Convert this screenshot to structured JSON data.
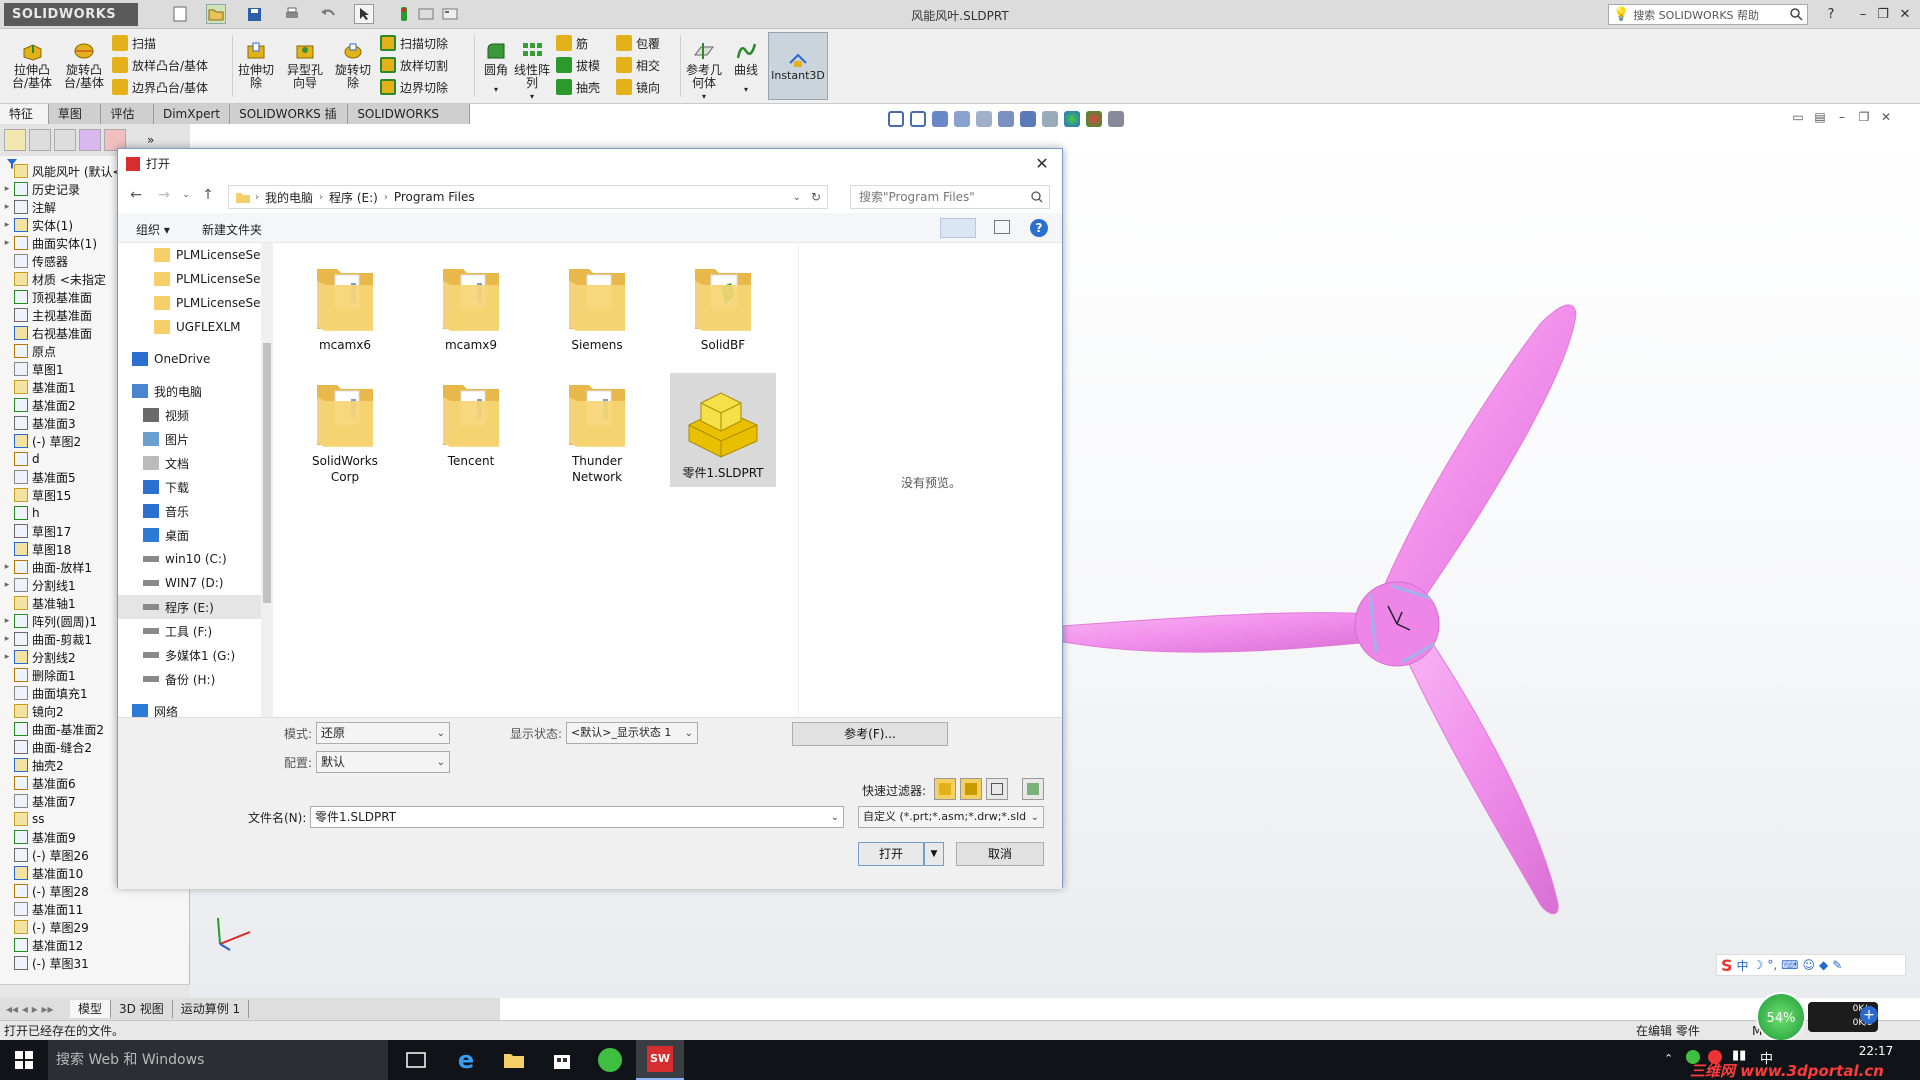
{
  "window": {
    "title": "风能风叶.SLDPRT",
    "logo_text": "SOLIDWORKS",
    "help_placeholder": "搜索 SOLIDWORKS 帮助"
  },
  "ribbon": {
    "big_buttons": [
      {
        "name": "extrude-boss",
        "label": "拉伸凸\n台/基体",
        "icon": "extrude-icon",
        "color": "#e3b21a"
      },
      {
        "name": "revolve-boss",
        "label": "旋转凸\n台/基体",
        "icon": "revolve-icon",
        "color": "#e3b21a"
      },
      {
        "name": "extrude-cut",
        "label": "拉伸切\n除",
        "icon": "cut-icon",
        "color": "#e3b21a"
      },
      {
        "name": "hole-wizard",
        "label": "异型孔\n向导",
        "icon": "hole-icon",
        "color": "#3a8f3a"
      },
      {
        "name": "revolve-cut",
        "label": "旋转切\n除",
        "icon": "revolve-cut-icon",
        "color": "#e3b21a"
      },
      {
        "name": "fillet",
        "label": "圆角",
        "icon": "fillet-icon",
        "color": "#3a9a3a"
      },
      {
        "name": "linear-pattern",
        "label": "线性阵\n列",
        "icon": "pattern-icon",
        "color": "#3a9a3a"
      },
      {
        "name": "ref-geometry",
        "label": "参考几\n何体",
        "icon": "plane-icon",
        "color": "#888888"
      },
      {
        "name": "curves",
        "label": "曲线",
        "icon": "curve-icon",
        "color": "#2a8a2a"
      }
    ],
    "small_col1": [
      "扫描",
      "放样凸台/基体",
      "边界凸台/基体"
    ],
    "small_col2": [
      "扫描切除",
      "放样切割",
      "边界切除"
    ],
    "small_col3": [
      "筋",
      "拔模",
      "抽壳"
    ],
    "small_col4": [
      "包覆",
      "相交",
      "镜向"
    ],
    "instant3d": "Instant3D"
  },
  "tabs": [
    "特征",
    "草图",
    "评估",
    "DimXpert",
    "SOLIDWORKS 插件",
    "SOLIDWORKS MBD"
  ],
  "tree": [
    {
      "label": "风能风叶  (默认<",
      "exp": ""
    },
    {
      "label": "历史记录",
      "exp": "▸"
    },
    {
      "label": "注解",
      "exp": "▸"
    },
    {
      "label": "实体(1)",
      "exp": "▸"
    },
    {
      "label": "曲面实体(1)",
      "exp": "▸"
    },
    {
      "label": "传感器",
      "exp": ""
    },
    {
      "label": "材质 <未指定",
      "exp": ""
    },
    {
      "label": "顶视基准面",
      "exp": ""
    },
    {
      "label": "主视基准面",
      "exp": ""
    },
    {
      "label": "右视基准面",
      "exp": ""
    },
    {
      "label": "原点",
      "exp": ""
    },
    {
      "label": "草图1",
      "exp": ""
    },
    {
      "label": "基准面1",
      "exp": ""
    },
    {
      "label": "基准面2",
      "exp": ""
    },
    {
      "label": "基准面3",
      "exp": ""
    },
    {
      "label": "(-) 草图2",
      "exp": ""
    },
    {
      "label": "d",
      "exp": ""
    },
    {
      "label": "基准面5",
      "exp": ""
    },
    {
      "label": "草图15",
      "exp": ""
    },
    {
      "label": "h",
      "exp": ""
    },
    {
      "label": "草图17",
      "exp": ""
    },
    {
      "label": "草图18",
      "exp": ""
    },
    {
      "label": "曲面-放样1",
      "exp": "▸"
    },
    {
      "label": "分割线1",
      "exp": "▸"
    },
    {
      "label": "基准轴1",
      "exp": ""
    },
    {
      "label": "阵列(圆周)1",
      "exp": "▸"
    },
    {
      "label": "曲面-剪裁1",
      "exp": "▸"
    },
    {
      "label": "分割线2",
      "exp": "▸"
    },
    {
      "label": "删除面1",
      "exp": ""
    },
    {
      "label": "曲面填充1",
      "exp": ""
    },
    {
      "label": "镜向2",
      "exp": ""
    },
    {
      "label": "曲面-基准面2",
      "exp": ""
    },
    {
      "label": "曲面-缝合2",
      "exp": ""
    },
    {
      "label": "抽壳2",
      "exp": ""
    },
    {
      "label": "基准面6",
      "exp": ""
    },
    {
      "label": "基准面7",
      "exp": ""
    },
    {
      "label": "ss",
      "exp": ""
    },
    {
      "label": "基准面9",
      "exp": ""
    },
    {
      "label": "(-) 草图26",
      "exp": ""
    },
    {
      "label": "基准面10",
      "exp": ""
    },
    {
      "label": "(-) 草图28",
      "exp": ""
    },
    {
      "label": "基准面11",
      "exp": ""
    },
    {
      "label": "(-) 草图29",
      "exp": ""
    },
    {
      "label": "基准面12",
      "exp": ""
    },
    {
      "label": "(-) 草图31",
      "exp": ""
    }
  ],
  "bottom_tabs": [
    "模型",
    "3D 视图",
    "运动算例 1"
  ],
  "status": {
    "left": "打开已经存在的文件。",
    "right": "在编辑 零件",
    "right2": "MMGS"
  },
  "taskbar": {
    "search": "搜索 Web 和 Windows",
    "time": "22:17",
    "watermark": "三维网 www.3dportal.cn",
    "net_up": "0K/s",
    "net_down": "0K/s",
    "cpu": "54%"
  },
  "dialog": {
    "title": "打开",
    "breadcrumb": [
      "我的电脑",
      "程序 (E:)",
      "Program Files"
    ],
    "search_placeholder": "搜索\"Program Files\"",
    "organize": "组织 ▾",
    "new_folder": "新建文件夹",
    "nav_items": [
      {
        "label": "PLMLicenseSer",
        "icon": "folder-icon",
        "indent": 2
      },
      {
        "label": "PLMLicenseSer",
        "icon": "folder-icon",
        "indent": 2
      },
      {
        "label": "PLMLicenseSer",
        "icon": "folder-icon",
        "indent": 2
      },
      {
        "label": "UGFLEXLM",
        "icon": "folder-icon",
        "indent": 2
      },
      {
        "label": "",
        "icon": "",
        "indent": 0
      },
      {
        "label": "OneDrive",
        "icon": "cloud-icon",
        "indent": 0
      },
      {
        "label": "",
        "icon": "",
        "indent": 0
      },
      {
        "label": "我的电脑",
        "icon": "computer-icon",
        "indent": 0
      },
      {
        "label": "视频",
        "icon": "video-icon",
        "indent": 1
      },
      {
        "label": "图片",
        "icon": "picture-icon",
        "indent": 1
      },
      {
        "label": "文档",
        "icon": "document-icon",
        "indent": 1
      },
      {
        "label": "下载",
        "icon": "download-icon",
        "indent": 1
      },
      {
        "label": "音乐",
        "icon": "music-icon",
        "indent": 1
      },
      {
        "label": "桌面",
        "icon": "desktop-icon",
        "indent": 1
      },
      {
        "label": "win10 (C:)",
        "icon": "drive-icon",
        "indent": 1
      },
      {
        "label": "WIN7 (D:)",
        "icon": "drive-icon",
        "indent": 1
      },
      {
        "label": "程序 (E:)",
        "icon": "drive-icon",
        "indent": 1,
        "selected": true
      },
      {
        "label": "工具 (F:)",
        "icon": "drive-icon",
        "indent": 1
      },
      {
        "label": "多媒体1 (G:)",
        "icon": "drive-icon",
        "indent": 1
      },
      {
        "label": "备份 (H:)",
        "icon": "drive-icon",
        "indent": 1
      },
      {
        "label": "",
        "icon": "",
        "indent": 0
      },
      {
        "label": "网络",
        "icon": "network-icon",
        "indent": 0
      }
    ],
    "files": [
      {
        "label": "mcamx6",
        "kind": "folder-docs"
      },
      {
        "label": "mcamx9",
        "kind": "folder-docs"
      },
      {
        "label": "Siemens",
        "kind": "folder"
      },
      {
        "label": "SolidBF",
        "kind": "folder-green"
      },
      {
        "label": "SolidWorks\nCorp",
        "kind": "folder-docs"
      },
      {
        "label": "Tencent",
        "kind": "folder-docs"
      },
      {
        "label": "Thunder\nNetwork",
        "kind": "folder-docs"
      },
      {
        "label": "零件1.SLDPRT",
        "kind": "part",
        "selected": true
      }
    ],
    "no_preview": "没有预览。",
    "mode_label": "模式:",
    "mode_value": "还原",
    "config_label": "配置:",
    "config_value": "默认",
    "display_state_label": "显示状态:",
    "display_state_value": "<默认>_显示状态 1",
    "references_button": "参考(F)...",
    "quick_filter_label": "快速过滤器:",
    "filename_label": "文件名(N):",
    "filename_value": "零件1.SLDPRT",
    "filetype_value": "自定义 (*.prt;*.asm;*.drw;*.sld",
    "open_button": "打开",
    "cancel_button": "取消"
  },
  "colors": {
    "accent": "#2b7bd6",
    "folder": "#f5cf68",
    "blade": "#f291ec",
    "part": "#f2d21a"
  }
}
